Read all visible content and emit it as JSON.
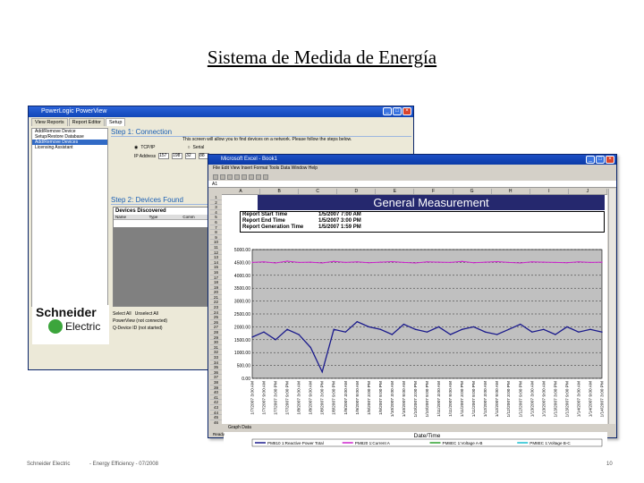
{
  "slide": {
    "title": "Sistema de Medida de Energía",
    "footer_left": "Schneider Electric",
    "footer_mid": "- Energy Efficiency - 07/2008",
    "footer_right": "10"
  },
  "powerlogic": {
    "title": "PowerLogic PowerView",
    "tabs": [
      "View Reports",
      "Report Editor",
      "Setup"
    ],
    "tree": [
      "Add/Remove Device",
      "Setup/Restore Database",
      "Add/Remove Devices",
      "Licensing Assistant"
    ],
    "step1_title": "Step 1: Connection",
    "step1_note": "This screen will allow you to find devices on a network. Please follow the steps below.",
    "radio_serial": "Serial",
    "radio_tcpip": "TCP/IP",
    "ip_label": "IP Address",
    "ip_octets": [
      "157",
      "198",
      "32",
      "88"
    ],
    "step2_title": "Step 2: Devices Found",
    "devices_header": "Devices Discovered",
    "device_columns": [
      "Name",
      "Type",
      "Comm"
    ],
    "bottom_lines": [
      "Select All",
      "Unselect All",
      "PowerView (not connected)",
      "Q-Device ID (not started)"
    ],
    "logo_brand": "Schneider",
    "logo_sub": "Electric"
  },
  "excel": {
    "title": "Microsoft Excel - Book1",
    "menu": "File  Edit  View  Insert  Format  Tools  Data  Window  Help",
    "cell_ref": "A1",
    "columns": [
      "A",
      "B",
      "C",
      "D",
      "E",
      "F",
      "G",
      "H",
      "I",
      "J"
    ],
    "report_title": "General Measurement",
    "report_rows": [
      {
        "label": "Report Start Time",
        "value": "1/5/2007 7:00 AM"
      },
      {
        "label": "Report End Time",
        "value": "1/5/2007 3:00 PM"
      },
      {
        "label": "Report Generation Time",
        "value": "1/5/2007 1:59 PM"
      }
    ],
    "sheet_tabs": "Graph  Data",
    "status": "Ready"
  },
  "chart_data": {
    "type": "line",
    "xlabel": "Date/Time",
    "ylabel": "",
    "ylim": [
      0,
      5000
    ],
    "yticks": [
      "5000.00",
      "4500.00",
      "4000.00",
      "3500.00",
      "3000.00",
      "2500.00",
      "2000.00",
      "1500.00",
      "1000.00",
      "500.00",
      "0.00"
    ],
    "x": [
      "1/7/2007 3:00 AM",
      "1/7/2007 9:00 AM",
      "1/7/2007 3:00 PM",
      "1/7/2007 9:00 PM",
      "1/8/2007 3:00 AM",
      "1/8/2007 9:00 AM",
      "1/8/2007 3:00 PM",
      "1/8/2007 9:00 PM",
      "1/9/2007 3:00 AM",
      "1/9/2007 9:00 AM",
      "1/9/2007 3:00 PM",
      "1/9/2007 9:00 PM",
      "1/10/2007 3:00 AM",
      "1/10/2007 9:00 AM",
      "1/10/2007 3:00 PM",
      "1/10/2007 9:00 PM",
      "1/11/2007 3:00 AM",
      "1/11/2007 9:00 AM",
      "1/11/2007 3:00 PM",
      "1/11/2007 9:00 PM",
      "1/12/2007 3:00 AM",
      "1/12/2007 9:00 AM",
      "1/12/2007 3:00 PM",
      "1/12/2007 9:00 PM",
      "1/13/2007 3:00 AM",
      "1/13/2007 9:00 AM",
      "1/13/2007 3:00 PM",
      "1/13/2007 9:00 PM",
      "1/14/2007 3:00 AM",
      "1/14/2007 9:00 AM",
      "1/14/2007 3:00 PM"
    ],
    "series": [
      {
        "name": "PM810 1:Reactive Power Total",
        "color": "#1a1a8c",
        "values": [
          1600,
          1800,
          1500,
          1900,
          1700,
          1200,
          250,
          1900,
          1800,
          2200,
          2000,
          1900,
          1700,
          2100,
          1900,
          1800,
          2000,
          1700,
          1900,
          2000,
          1800,
          1700,
          1900,
          2100,
          1800,
          1900,
          1700,
          2000,
          1800,
          1900,
          1800
        ]
      },
      {
        "name": "PM820 1:Current A",
        "color": "#cc22cc",
        "values": [
          4500,
          4520,
          4480,
          4550,
          4500,
          4510,
          4480,
          4540,
          4500,
          4520,
          4490,
          4510,
          4530,
          4500,
          4480,
          4520,
          4510,
          4500,
          4540,
          4490,
          4510,
          4530,
          4500,
          4480,
          4520,
          4510,
          4500,
          4490,
          4520,
          4500,
          4510
        ]
      },
      {
        "name": "PM8EC 1:Voltage A-B",
        "color": "#2ca02c",
        "values": []
      },
      {
        "name": "PM8EC 1:Voltage B-C",
        "color": "#17becf",
        "values": []
      }
    ],
    "grid": true,
    "legend": "bottom",
    "plot_bg": "#c0c0c0"
  }
}
